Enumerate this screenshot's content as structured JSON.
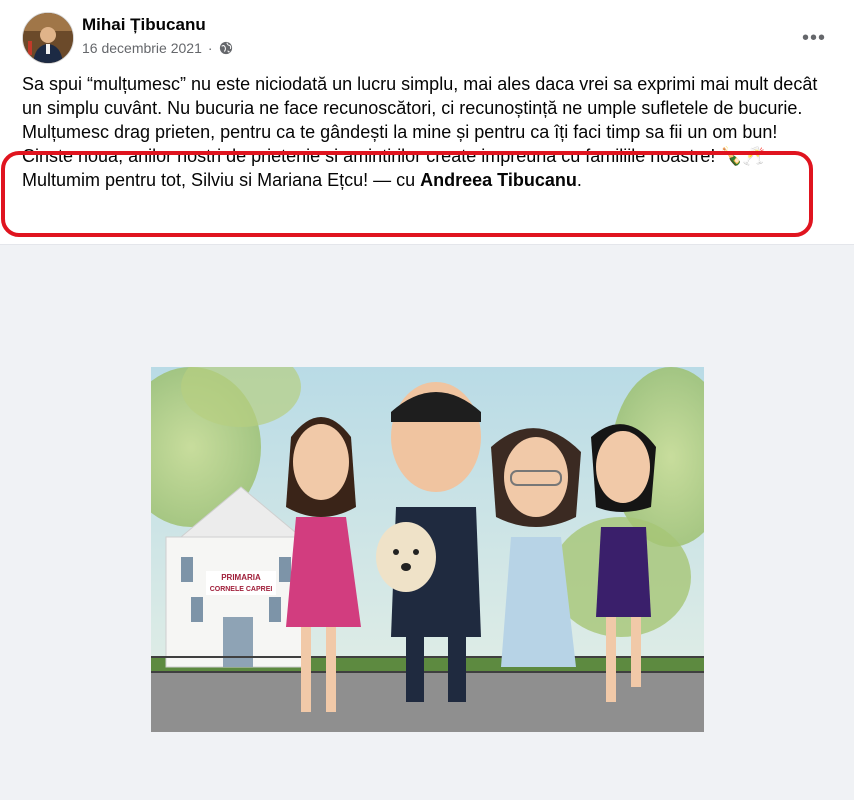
{
  "post": {
    "author": "Mihai Țibucanu",
    "date": "16 decembrie 2021",
    "more_icon": "•••",
    "text_line1": "Sa spui “mulțumesc” nu este niciodată un lucru simplu, mai ales daca vrei sa exprimi mai mult decât un simplu cuvânt. Nu bucuria ne face recunoscători, ci recunoștință ne umple sufletele de bucurie. Mulțumesc drag prieten, pentru ca te gândești la mine și pentru ca îți faci timp sa fii un om bun!",
    "text_line2": "Cinste noua, anilor nostri de prietenie si amintirilor create impreuna cu familiile noastre! 🍾🥂",
    "text_line3_prefix": "Multumim pentru tot, Silviu si Mariana Ețcu! — cu ",
    "tagged_person": "Andreea Tibucanu",
    "text_line3_suffix": "."
  },
  "photo": {
    "building_sign_line1": "PRIMARIA",
    "building_sign_line2": "CORNELE CAPREI"
  },
  "colors": {
    "highlight": "#e0141f",
    "secondary_text": "#65676b",
    "photo_bg": "#f0f2f5"
  }
}
